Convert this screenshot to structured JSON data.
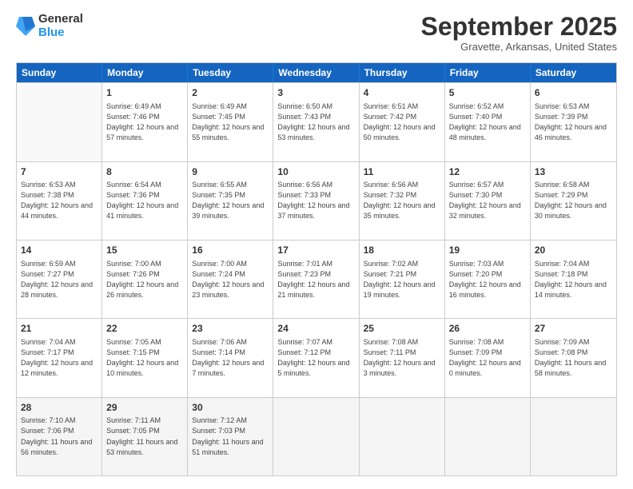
{
  "logo": {
    "general": "General",
    "blue": "Blue"
  },
  "title": "September 2025",
  "subtitle": "Gravette, Arkansas, United States",
  "days_of_week": [
    "Sunday",
    "Monday",
    "Tuesday",
    "Wednesday",
    "Thursday",
    "Friday",
    "Saturday"
  ],
  "weeks": [
    [
      {
        "day": "",
        "empty": true
      },
      {
        "day": "1",
        "sunrise": "6:49 AM",
        "sunset": "7:46 PM",
        "daylight": "12 hours and 57 minutes."
      },
      {
        "day": "2",
        "sunrise": "6:49 AM",
        "sunset": "7:45 PM",
        "daylight": "12 hours and 55 minutes."
      },
      {
        "day": "3",
        "sunrise": "6:50 AM",
        "sunset": "7:43 PM",
        "daylight": "12 hours and 53 minutes."
      },
      {
        "day": "4",
        "sunrise": "6:51 AM",
        "sunset": "7:42 PM",
        "daylight": "12 hours and 50 minutes."
      },
      {
        "day": "5",
        "sunrise": "6:52 AM",
        "sunset": "7:40 PM",
        "daylight": "12 hours and 48 minutes."
      },
      {
        "day": "6",
        "sunrise": "6:53 AM",
        "sunset": "7:39 PM",
        "daylight": "12 hours and 46 minutes."
      }
    ],
    [
      {
        "day": "7",
        "sunrise": "6:53 AM",
        "sunset": "7:38 PM",
        "daylight": "12 hours and 44 minutes."
      },
      {
        "day": "8",
        "sunrise": "6:54 AM",
        "sunset": "7:36 PM",
        "daylight": "12 hours and 41 minutes."
      },
      {
        "day": "9",
        "sunrise": "6:55 AM",
        "sunset": "7:35 PM",
        "daylight": "12 hours and 39 minutes."
      },
      {
        "day": "10",
        "sunrise": "6:56 AM",
        "sunset": "7:33 PM",
        "daylight": "12 hours and 37 minutes."
      },
      {
        "day": "11",
        "sunrise": "6:56 AM",
        "sunset": "7:32 PM",
        "daylight": "12 hours and 35 minutes."
      },
      {
        "day": "12",
        "sunrise": "6:57 AM",
        "sunset": "7:30 PM",
        "daylight": "12 hours and 32 minutes."
      },
      {
        "day": "13",
        "sunrise": "6:58 AM",
        "sunset": "7:29 PM",
        "daylight": "12 hours and 30 minutes."
      }
    ],
    [
      {
        "day": "14",
        "sunrise": "6:59 AM",
        "sunset": "7:27 PM",
        "daylight": "12 hours and 28 minutes."
      },
      {
        "day": "15",
        "sunrise": "7:00 AM",
        "sunset": "7:26 PM",
        "daylight": "12 hours and 26 minutes."
      },
      {
        "day": "16",
        "sunrise": "7:00 AM",
        "sunset": "7:24 PM",
        "daylight": "12 hours and 23 minutes."
      },
      {
        "day": "17",
        "sunrise": "7:01 AM",
        "sunset": "7:23 PM",
        "daylight": "12 hours and 21 minutes."
      },
      {
        "day": "18",
        "sunrise": "7:02 AM",
        "sunset": "7:21 PM",
        "daylight": "12 hours and 19 minutes."
      },
      {
        "day": "19",
        "sunrise": "7:03 AM",
        "sunset": "7:20 PM",
        "daylight": "12 hours and 16 minutes."
      },
      {
        "day": "20",
        "sunrise": "7:04 AM",
        "sunset": "7:18 PM",
        "daylight": "12 hours and 14 minutes."
      }
    ],
    [
      {
        "day": "21",
        "sunrise": "7:04 AM",
        "sunset": "7:17 PM",
        "daylight": "12 hours and 12 minutes."
      },
      {
        "day": "22",
        "sunrise": "7:05 AM",
        "sunset": "7:15 PM",
        "daylight": "12 hours and 10 minutes."
      },
      {
        "day": "23",
        "sunrise": "7:06 AM",
        "sunset": "7:14 PM",
        "daylight": "12 hours and 7 minutes."
      },
      {
        "day": "24",
        "sunrise": "7:07 AM",
        "sunset": "7:12 PM",
        "daylight": "12 hours and 5 minutes."
      },
      {
        "day": "25",
        "sunrise": "7:08 AM",
        "sunset": "7:11 PM",
        "daylight": "12 hours and 3 minutes."
      },
      {
        "day": "26",
        "sunrise": "7:08 AM",
        "sunset": "7:09 PM",
        "daylight": "12 hours and 0 minutes."
      },
      {
        "day": "27",
        "sunrise": "7:09 AM",
        "sunset": "7:08 PM",
        "daylight": "11 hours and 58 minutes."
      }
    ],
    [
      {
        "day": "28",
        "sunrise": "7:10 AM",
        "sunset": "7:06 PM",
        "daylight": "11 hours and 56 minutes."
      },
      {
        "day": "29",
        "sunrise": "7:11 AM",
        "sunset": "7:05 PM",
        "daylight": "11 hours and 53 minutes."
      },
      {
        "day": "30",
        "sunrise": "7:12 AM",
        "sunset": "7:03 PM",
        "daylight": "11 hours and 51 minutes."
      },
      {
        "day": "",
        "empty": true
      },
      {
        "day": "",
        "empty": true
      },
      {
        "day": "",
        "empty": true
      },
      {
        "day": "",
        "empty": true
      }
    ]
  ]
}
